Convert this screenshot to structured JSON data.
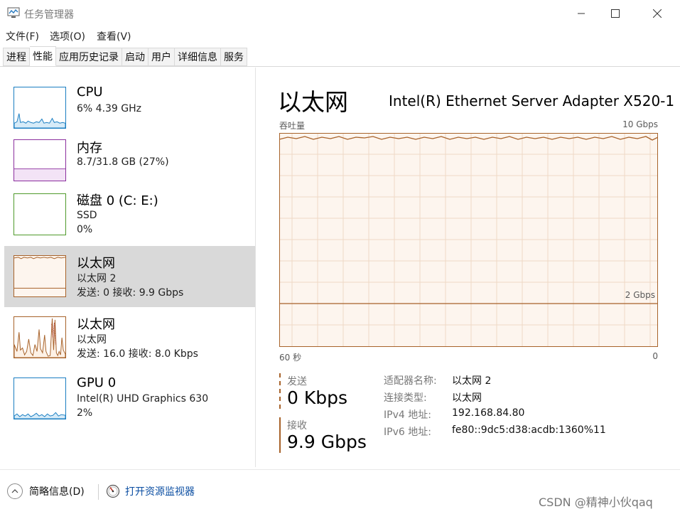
{
  "window": {
    "title": "任务管理器",
    "colors": {
      "network_accent": "#a7622a",
      "network_fill": "#fdf5ee",
      "selected_bg": "#d9d9d9",
      "link": "#0b4ea2"
    }
  },
  "menu": [
    "文件(F)",
    "选项(O)",
    "查看(V)"
  ],
  "tabs": [
    {
      "label": "进程"
    },
    {
      "label": "性能",
      "active": true
    },
    {
      "label": "应用历史记录"
    },
    {
      "label": "启动"
    },
    {
      "label": "用户"
    },
    {
      "label": "详细信息"
    },
    {
      "label": "服务"
    }
  ],
  "sidebar": {
    "items": [
      {
        "title": "CPU",
        "sub1": "6% 4.39 GHz",
        "sub2": "",
        "color": "#1a7ec2"
      },
      {
        "title": "内存",
        "sub1": "8.7/31.8 GB (27%)",
        "sub2": "",
        "color": "#8b2f9e"
      },
      {
        "title": "磁盘 0 (C: E:)",
        "sub1": "SSD",
        "sub2": "0%",
        "color": "#4f9a2b"
      },
      {
        "title": "以太网",
        "sub1": "以太网 2",
        "sub2": "发送: 0 接收: 9.9 Gbps",
        "color": "#a7622a",
        "selected": true
      },
      {
        "title": "以太网",
        "sub1": "以太网",
        "sub2": "发送: 16.0 接收: 8.0 Kbps",
        "color": "#a7622a"
      },
      {
        "title": "GPU 0",
        "sub1": "Intel(R) UHD Graphics 630",
        "sub2": "2%",
        "color": "#1a7ec2"
      }
    ]
  },
  "main": {
    "title": "以太网",
    "adapter": "Intel(R) Ethernet Server Adapter X520-1",
    "graph": {
      "y_label": "吞吐量",
      "y_max": "10 Gbps",
      "mid_label": "2 Gbps",
      "x_left": "60 秒",
      "x_right": "0"
    },
    "send": {
      "label": "发送",
      "value": "0 Kbps"
    },
    "receive": {
      "label": "接收",
      "value": "9.9 Gbps"
    },
    "info": [
      {
        "key": "适配器名称:",
        "value": "以太网 2"
      },
      {
        "key": "连接类型:",
        "value": "以太网"
      },
      {
        "key": "IPv4 地址:",
        "value": "192.168.84.80"
      },
      {
        "key": "IPv6 地址:",
        "value": "fe80::9dc5:d38:acdb:1360%11"
      }
    ]
  },
  "footer": {
    "fewer_details": "简略信息(D)",
    "open_resmon": "打开资源监视器"
  },
  "watermark": "CSDN @精神小伙qaq"
}
